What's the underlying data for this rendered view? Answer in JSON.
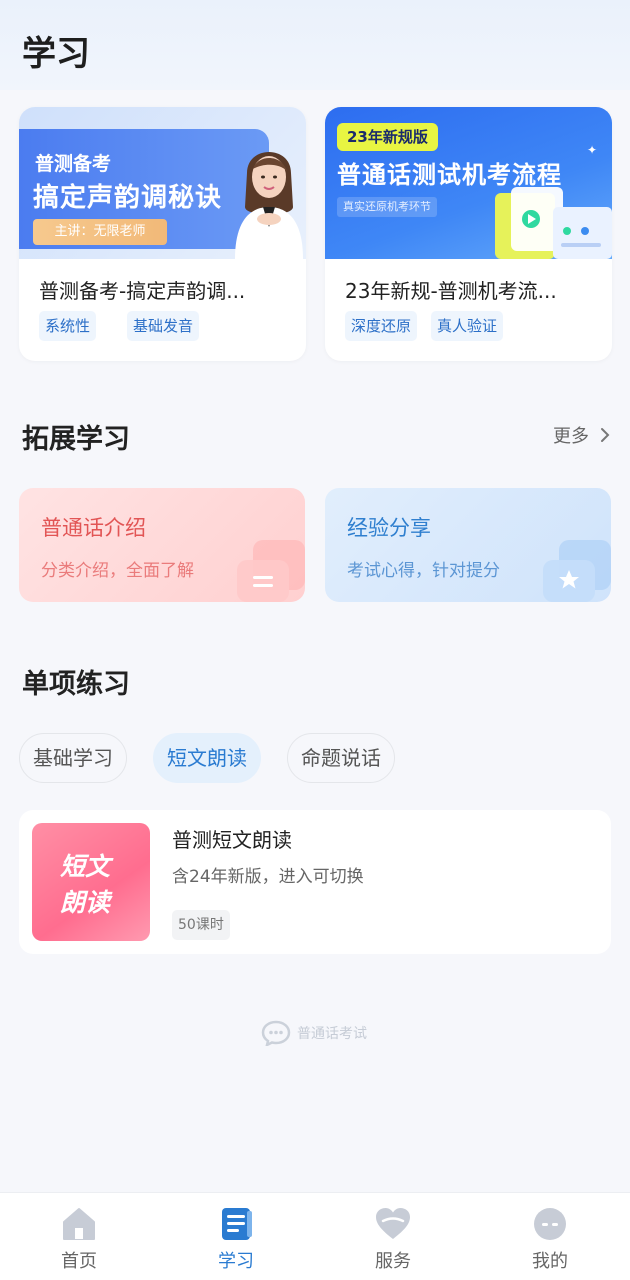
{
  "header": {
    "title": "学习"
  },
  "courses": [
    {
      "banner_line1": "普测备考",
      "banner_line2": "搞定声韵调秘诀",
      "banner_teacher": "主讲：无限老师",
      "title": "普测备考-搞定声韵调...",
      "tags": [
        "系统性",
        "基础发音"
      ]
    },
    {
      "banner_badge": "23年新规版",
      "banner_title": "普通话测试机考流程",
      "banner_sub": "真实还原机考环节",
      "title": "23年新规-普测机考流...",
      "tags": [
        "深度还原",
        "真人验证"
      ]
    }
  ],
  "extension": {
    "title": "拓展学习",
    "more": "更多",
    "cards": [
      {
        "title": "普通话介绍",
        "subtitle": "分类介绍，全面了解"
      },
      {
        "title": "经验分享",
        "subtitle": "考试心得，针对提分"
      }
    ]
  },
  "practice": {
    "title": "单项练习",
    "tabs": [
      "基础学习",
      "短文朗读",
      "命题说话"
    ],
    "active_tab": "短文朗读",
    "item": {
      "thumb_line1": "短文",
      "thumb_line2": "朗读",
      "title": "普测短文朗读",
      "subtitle": "含24年新版，进入可切换",
      "badge": "50课时"
    }
  },
  "footer_brand": "普通话考试",
  "bottom_nav": {
    "items": [
      "首页",
      "学习",
      "服务",
      "我的"
    ],
    "active": "学习"
  },
  "colors": {
    "accent": "#2a7bd1",
    "pink_card": "#ffd9d9",
    "blue_card": "#d8e9fc"
  }
}
